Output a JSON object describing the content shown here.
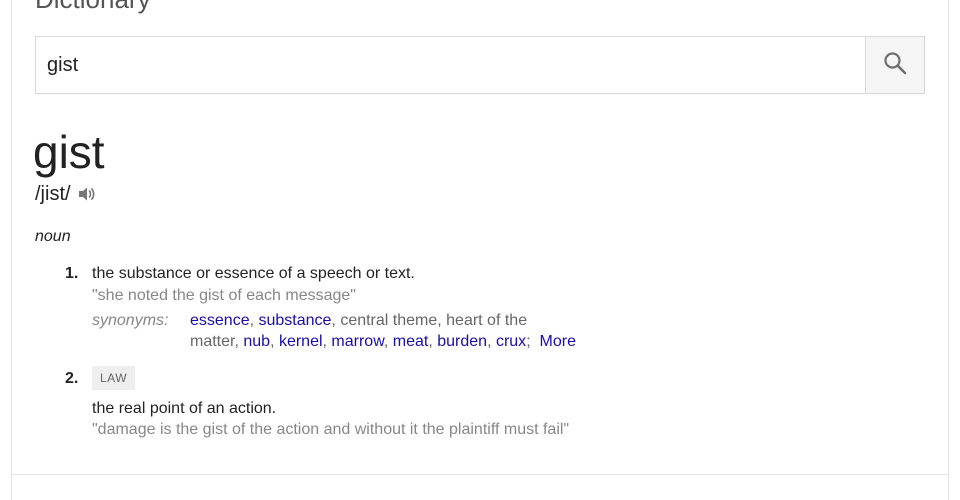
{
  "header": {
    "title": "Dictionary"
  },
  "search": {
    "value": "gist",
    "button_icon": "search-icon"
  },
  "entry": {
    "word": "gist",
    "pronunciation": "/jist/",
    "audio_icon": "speaker-icon",
    "part_of_speech": "noun",
    "senses": [
      {
        "number": "1.",
        "definition": "the substance or essence of a speech or text.",
        "example": "\"she noted the gist of each message\"",
        "synonyms_label": "synonyms:",
        "synonyms": [
          {
            "text": "essence",
            "link": true,
            "sep": ", "
          },
          {
            "text": "substance",
            "link": true,
            "sep": ", "
          },
          {
            "text": "central theme",
            "link": false,
            "sep": ", "
          },
          {
            "text": "heart of the matter",
            "link": false,
            "sep": ", "
          },
          {
            "text": "nub",
            "link": true,
            "sep": ", "
          },
          {
            "text": "kernel",
            "link": true,
            "sep": ", "
          },
          {
            "text": "marrow",
            "link": true,
            "sep": ", "
          },
          {
            "text": "meat",
            "link": true,
            "sep": ", "
          },
          {
            "text": "burden",
            "link": true,
            "sep": ", "
          },
          {
            "text": "crux",
            "link": true,
            "sep": ";  "
          },
          {
            "text": "More",
            "link": true,
            "sep": ""
          }
        ]
      },
      {
        "number": "2.",
        "domain": "LAW",
        "definition": "the real point of an action.",
        "example": "\"damage is the gist of the action and without it the plaintiff must fail\""
      }
    ]
  },
  "colors": {
    "link": "#1a0dab",
    "example_text": "#878787",
    "border": "#d9d9d9"
  }
}
